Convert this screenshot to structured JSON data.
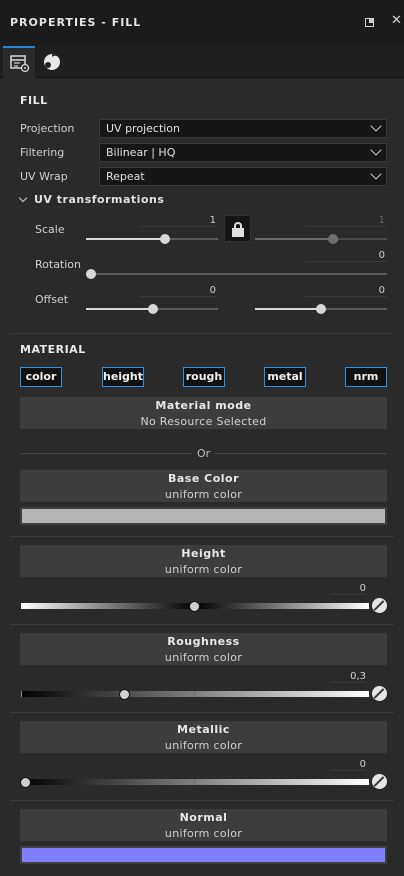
{
  "header": {
    "title": "PROPERTIES - FILL"
  },
  "tabs": [
    {
      "icon": "fill-properties-icon"
    },
    {
      "icon": "material-sphere-icon"
    }
  ],
  "fill": {
    "section_title": "FILL",
    "projection_label": "Projection",
    "projection_value": "UV projection",
    "filtering_label": "Filtering",
    "filtering_value": "Bilinear | HQ",
    "uvwrap_label": "UV Wrap",
    "uvwrap_value": "Repeat"
  },
  "uv": {
    "title": "UV transformations",
    "scale_label": "Scale",
    "scale_u": "1",
    "scale_v": "1",
    "rotation_label": "Rotation",
    "rotation_value": "0",
    "offset_label": "Offset",
    "offset_u": "0",
    "offset_v": "0"
  },
  "material": {
    "section_title": "MATERIAL",
    "channels": [
      "color",
      "height",
      "rough",
      "metal",
      "nrm"
    ],
    "mode_title": "Material mode",
    "mode_sub": "No Resource Selected",
    "or_text": "Or",
    "base_color_title": "Base Color",
    "base_color_sub": "uniform color",
    "base_color_swatch": "#b5b5b5",
    "height_title": "Height",
    "height_sub": "uniform color",
    "height_value": "0",
    "rough_title": "Roughness",
    "rough_sub": "uniform color",
    "rough_value": "0,3",
    "metal_title": "Metallic",
    "metal_sub": "uniform color",
    "metal_value": "0",
    "normal_title": "Normal",
    "normal_sub": "uniform color",
    "normal_swatch": "#7f7fff"
  },
  "colors": {
    "accent": "#2f8fe6",
    "panel": "#2a2a2a"
  }
}
